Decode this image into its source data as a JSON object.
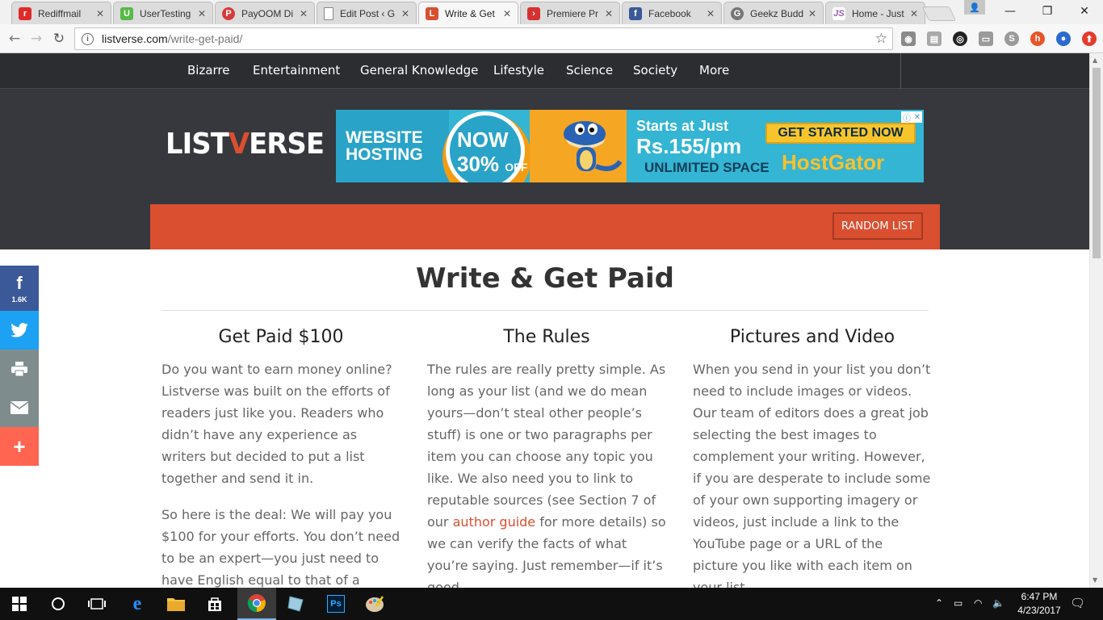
{
  "browser": {
    "tabs": [
      {
        "title": "Rediffmail",
        "icon": "rediff-icon",
        "glyph": "r",
        "color": "#e02a2a"
      },
      {
        "title": "UserTesting",
        "icon": "usertesting-icon",
        "glyph": "U",
        "color": "#57b947"
      },
      {
        "title": "PayOOM Di",
        "icon": "payoom-icon",
        "glyph": "P",
        "color": "#d63a3a"
      },
      {
        "title": "Edit Post ‹ G",
        "icon": "document-icon",
        "glyph": "",
        "color": "#ffffff"
      },
      {
        "title": "Write & Get",
        "icon": "listverse-icon",
        "glyph": "L",
        "color": "#d94f30"
      },
      {
        "title": "Premiere Pr",
        "icon": "premiere-icon",
        "glyph": "›",
        "color": "#d63031"
      },
      {
        "title": "Facebook",
        "icon": "facebook-icon",
        "glyph": "f",
        "color": "#3b5998"
      },
      {
        "title": "Geekz Budd",
        "icon": "geekz-icon",
        "glyph": "G",
        "color": "#777777"
      },
      {
        "title": "Home - Just",
        "icon": "justhost-icon",
        "glyph": "JS",
        "color": "#ffffff"
      }
    ],
    "url_host": "listverse.com",
    "url_path": "/write-get-paid/"
  },
  "nav": {
    "items": [
      "Bizarre",
      "Entertainment",
      "General Knowledge",
      "Lifestyle",
      "Science",
      "Society",
      "More"
    ]
  },
  "logo": {
    "before": "LIST",
    "accent": "V",
    "after": "ERSE"
  },
  "ad": {
    "website_hosting": "WEBSITE HOSTING",
    "now": "NOW",
    "percent": "30%",
    "off": "OFF",
    "starts": "Starts at Just",
    "price": "Rs.155/pm",
    "unlimited": "UNLIMITED SPACE",
    "cta": "GET STARTED NOW",
    "brand": "HostGator"
  },
  "random_list": "RANDOM LIST",
  "page": {
    "title": "Write & Get Paid",
    "columns": [
      {
        "heading": "Get Paid $100",
        "paragraphs": [
          "Do you want to earn money online? Listverse was built on the efforts of readers just like you. Readers who didn’t have any experience as writers but decided to put a list together and send it in.",
          "So here is the deal: We will pay you $100 for your efforts. You don’t need to be an expert—you just need to have English equal to that of a native"
        ]
      },
      {
        "heading": "The Rules",
        "p1_before": "The rules are really pretty simple. As long as your list (and we do mean yours—don’t steal other people’s stuff) is one or two paragraphs per item you can choose any topic you like. We also need you to link to reputable sources (see Section 7 of our ",
        "p1_link": "author guide",
        "p1_after": " for more details) so we can verify the facts of what you’re saying. Just remember—if it’s good"
      },
      {
        "heading": "Pictures and Video",
        "paragraphs": [
          "When you send in your list you don’t need to include images or videos. Our team of editors does a great job selecting the best images to complement your writing. However, if you are desperate to include some of your own supporting imagery or videos, just include a link to the YouTube page or a URL of the picture you like with each item on your list."
        ]
      }
    ]
  },
  "share": {
    "facebook_count": "1.6K",
    "colors": {
      "facebook": "#3b5998",
      "twitter": "#1da1f2",
      "print": "#7f8c8d",
      "email": "#7f8c8d",
      "more": "#ff6550"
    }
  },
  "taskbar": {
    "time": "6:47 PM",
    "date": "4/23/2017"
  }
}
